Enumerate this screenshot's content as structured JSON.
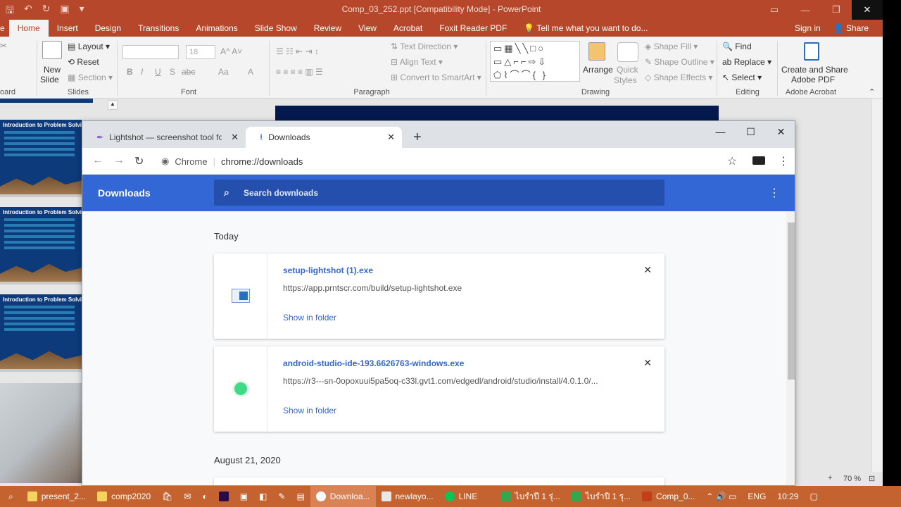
{
  "ppt": {
    "title": "Comp_03_252.ppt [Compatibility Mode] - PowerPoint",
    "tabs": [
      "Home",
      "Insert",
      "Design",
      "Transitions",
      "Animations",
      "Slide Show",
      "Review",
      "View",
      "Acrobat",
      "Foxit Reader PDF"
    ],
    "tell_me": "Tell me what you want to do...",
    "sign_in": "Sign in",
    "share": "Share",
    "groups": {
      "clipboard": "oard",
      "slides": "Slides",
      "font": "Font",
      "paragraph": "Paragraph",
      "drawing": "Drawing",
      "editing": "Editing",
      "acrobat": "Adobe Acrobat"
    },
    "ribbon": {
      "new_slide_1": "New",
      "new_slide_2": "Slide",
      "layout": "Layout",
      "reset": "Reset",
      "section": "Section",
      "font_size": "18",
      "text_direction": "Text Direction",
      "align_text": "Align Text",
      "convert_smartart": "Convert to SmartArt",
      "arrange": "Arrange",
      "quick_styles_1": "Quick",
      "quick_styles_2": "Styles",
      "shape_fill": "Shape Fill",
      "shape_outline": "Shape Outline",
      "shape_effects": "Shape Effects",
      "find": "Find",
      "replace": "Replace",
      "select": "Select",
      "create_share_1": "Create and Share",
      "create_share_2": "Adobe PDF"
    },
    "thumb_title": "Introduction to Problem Solvi",
    "zoom": "70 %"
  },
  "chrome": {
    "tabs": [
      {
        "label": "Lightshot — screenshot tool for M"
      },
      {
        "label": "Downloads"
      }
    ],
    "address_site": "Chrome",
    "address_url": "chrome://downloads",
    "page_title": "Downloads",
    "search_placeholder": "Search downloads",
    "groups": [
      {
        "date": "Today",
        "items": [
          {
            "name": "setup-lightshot (1).exe",
            "url": "https://app.prntscr.com/build/setup-lightshot.exe",
            "action": "Show in folder"
          },
          {
            "name": "android-studio-ide-193.6626763-windows.exe",
            "url": "https://r3---sn-0opoxuui5pa5oq-c33l.gvt1.com/edgedl/android/studio/install/4.0.1.0/...",
            "action": "Show in folder"
          }
        ]
      },
      {
        "date": "August 21, 2020"
      }
    ]
  },
  "taskbar": {
    "items": [
      "present_2...",
      "comp2020",
      "Downloa...",
      "newlayo...",
      "LINE",
      "ไบรำปี 1 รุ่...",
      "ไบรำปี 1 รุ...",
      "Comp_0..."
    ],
    "lang": "ENG",
    "time": "10:29"
  },
  "colors": {
    "ppt_accent": "#b7472a",
    "chrome_blue": "#3367d6",
    "taskbar": "#c4632f"
  }
}
